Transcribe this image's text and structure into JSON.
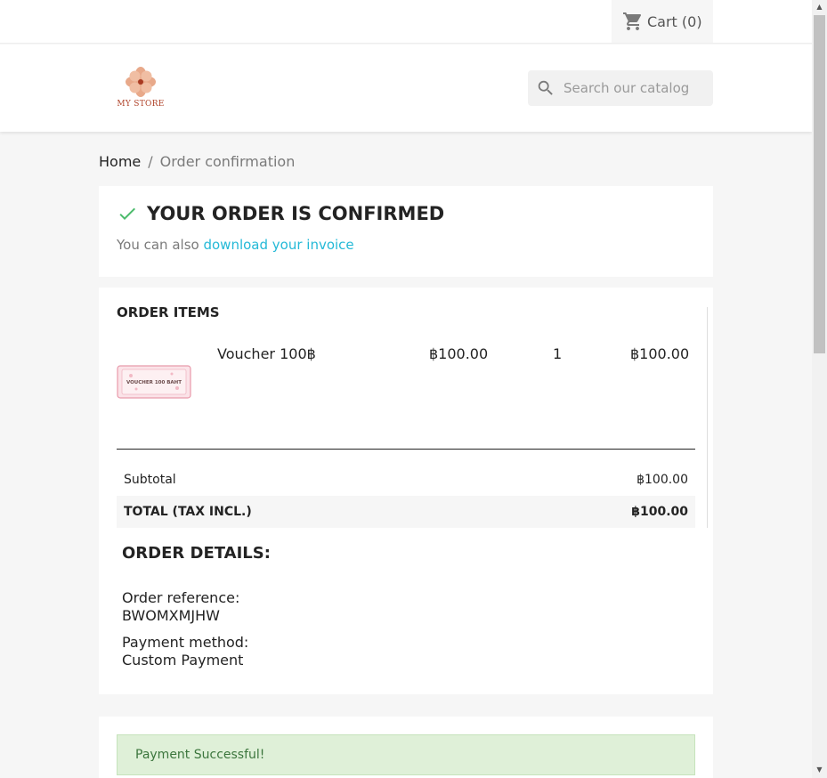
{
  "topbar": {
    "cart_label": "Cart (0)"
  },
  "header": {
    "logo_text": "MY STORE",
    "search_placeholder": "Search our catalog"
  },
  "breadcrumb": {
    "home": "Home",
    "separator": "/",
    "current": "Order confirmation"
  },
  "confirmation": {
    "title": "YOUR ORDER IS CONFIRMED",
    "subtitle_prefix": "You can also",
    "invoice_link": "download your invoice"
  },
  "order_items": {
    "title": "ORDER ITEMS",
    "items": [
      {
        "name": "Voucher 100฿",
        "thumbnail_text": "VOUCHER 100 BAHT",
        "unit_price": "฿100.00",
        "quantity": "1",
        "total": "฿100.00"
      }
    ],
    "subtotal_label": "Subtotal",
    "subtotal_value": "฿100.00",
    "total_label": "TOTAL (TAX INCL.)",
    "total_value": "฿100.00"
  },
  "order_details": {
    "title": "ORDER DETAILS:",
    "reference_label": "Order reference:",
    "reference_value": "BWOMXMJHW",
    "payment_label": "Payment method:",
    "payment_value": "Custom Payment"
  },
  "payment_message": "Payment Successful!",
  "colors": {
    "link": "#24b9d7",
    "check": "#4cbb6c",
    "success_bg": "#dff0d8",
    "success_text": "#3c763d",
    "logo": "#b0442b"
  },
  "icons": [
    "cart-icon",
    "search-icon",
    "check-icon",
    "logo-flower-icon"
  ]
}
